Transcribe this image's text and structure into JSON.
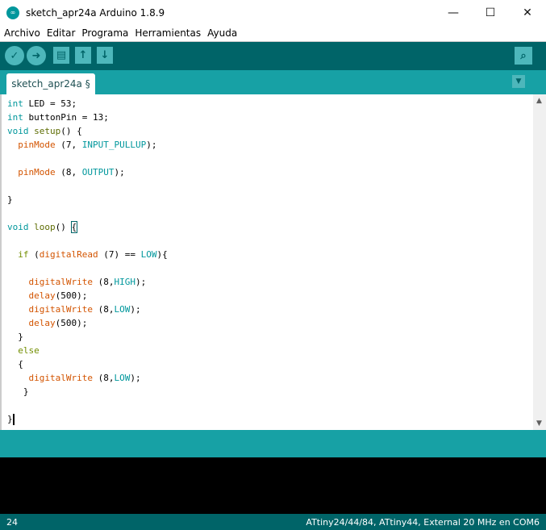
{
  "window": {
    "title": "sketch_apr24a Arduino 1.8.9",
    "minimize": "—",
    "maximize": "☐",
    "close": "✕"
  },
  "menu": [
    "Archivo",
    "Editar",
    "Programa",
    "Herramientas",
    "Ayuda"
  ],
  "toolbar": {
    "verify": "✓",
    "upload": "➜",
    "new": "▤",
    "open": "↑",
    "save": "↓",
    "serial_monitor": "⌕"
  },
  "tab": {
    "label": "sketch_apr24a §",
    "menu": "▼"
  },
  "colors": {
    "keyword": "#00979c",
    "function": "#5e6d03",
    "builtin": "#d35400",
    "constant": "#00979c",
    "control": "#728e00",
    "toolbar": "#006468",
    "tabbar": "#17a1a5"
  },
  "code": [
    [
      [
        "int",
        "keyword"
      ],
      [
        " LED = 53;",
        ""
      ]
    ],
    [
      [
        "int",
        "keyword"
      ],
      [
        " buttonPin = 13;",
        ""
      ]
    ],
    [
      [
        "void",
        "keyword"
      ],
      [
        " ",
        ""
      ],
      [
        "setup",
        "function"
      ],
      [
        "() {",
        ""
      ]
    ],
    [
      [
        "  ",
        ""
      ],
      [
        "pinMode",
        "builtin"
      ],
      [
        " (7, ",
        ""
      ],
      [
        "INPUT_PULLUP",
        "constant"
      ],
      [
        ");",
        ""
      ]
    ],
    [],
    [
      [
        "  ",
        ""
      ],
      [
        "pinMode",
        "builtin"
      ],
      [
        " (8, ",
        ""
      ],
      [
        "OUTPUT",
        "constant"
      ],
      [
        ");",
        ""
      ]
    ],
    [],
    [
      [
        "}",
        ""
      ]
    ],
    [],
    [
      [
        "void",
        "keyword"
      ],
      [
        " ",
        ""
      ],
      [
        "loop",
        "function"
      ],
      [
        "() ",
        ""
      ],
      [
        "{",
        "bracket"
      ]
    ],
    [],
    [
      [
        "  ",
        ""
      ],
      [
        "if",
        "control"
      ],
      [
        " (",
        ""
      ],
      [
        "digitalRead",
        "builtin"
      ],
      [
        " (7) == ",
        ""
      ],
      [
        "LOW",
        "constant"
      ],
      [
        "){",
        ""
      ]
    ],
    [],
    [
      [
        "    ",
        ""
      ],
      [
        "digitalWrite",
        "builtin"
      ],
      [
        " (8,",
        ""
      ],
      [
        "HIGH",
        "constant"
      ],
      [
        ");",
        ""
      ]
    ],
    [
      [
        "    ",
        ""
      ],
      [
        "delay",
        "builtin"
      ],
      [
        "(500);",
        ""
      ]
    ],
    [
      [
        "    ",
        ""
      ],
      [
        "digitalWrite",
        "builtin"
      ],
      [
        " (8,",
        ""
      ],
      [
        "LOW",
        "constant"
      ],
      [
        ");",
        ""
      ]
    ],
    [
      [
        "    ",
        ""
      ],
      [
        "delay",
        "builtin"
      ],
      [
        "(500);",
        ""
      ]
    ],
    [
      [
        "  }",
        ""
      ]
    ],
    [
      [
        "  ",
        ""
      ],
      [
        "else",
        "control"
      ]
    ],
    [
      [
        "  {",
        ""
      ]
    ],
    [
      [
        "    ",
        ""
      ],
      [
        "digitalWrite",
        "builtin"
      ],
      [
        " (8,",
        ""
      ],
      [
        "LOW",
        "constant"
      ],
      [
        ");",
        ""
      ]
    ],
    [
      [
        "   }",
        ""
      ]
    ],
    [],
    [
      [
        "}",
        ""
      ],
      [
        "",
        "cursor"
      ]
    ]
  ],
  "status": {
    "line": "24",
    "board": "ATtiny24/44/84, ATtiny44, External 20 MHz en COM6"
  }
}
